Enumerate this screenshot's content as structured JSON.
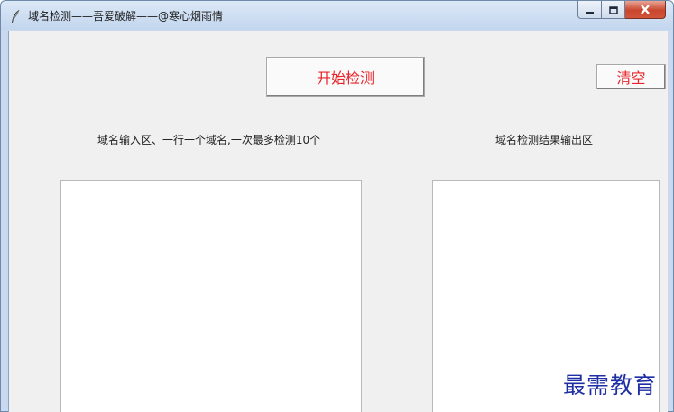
{
  "window": {
    "title": "域名检测——吾爱破解——@寒心烟雨情"
  },
  "toolbar": {
    "start_label": "开始检测",
    "clear_label": "清空"
  },
  "labels": {
    "input_area": "域名输入区、一行一个域名,一次最多检测10个",
    "output_area": "域名检测结果输出区"
  },
  "fields": {
    "input_value": "",
    "output_value": ""
  },
  "watermark": "最需教育",
  "colors": {
    "button_text": "#e8232a",
    "client_bg": "#f0f0f0",
    "watermark": "#1f2fa3"
  },
  "icons": {
    "app": "feather-icon",
    "minimize": "minimize-icon",
    "maximize": "maximize-icon",
    "close": "close-icon"
  }
}
